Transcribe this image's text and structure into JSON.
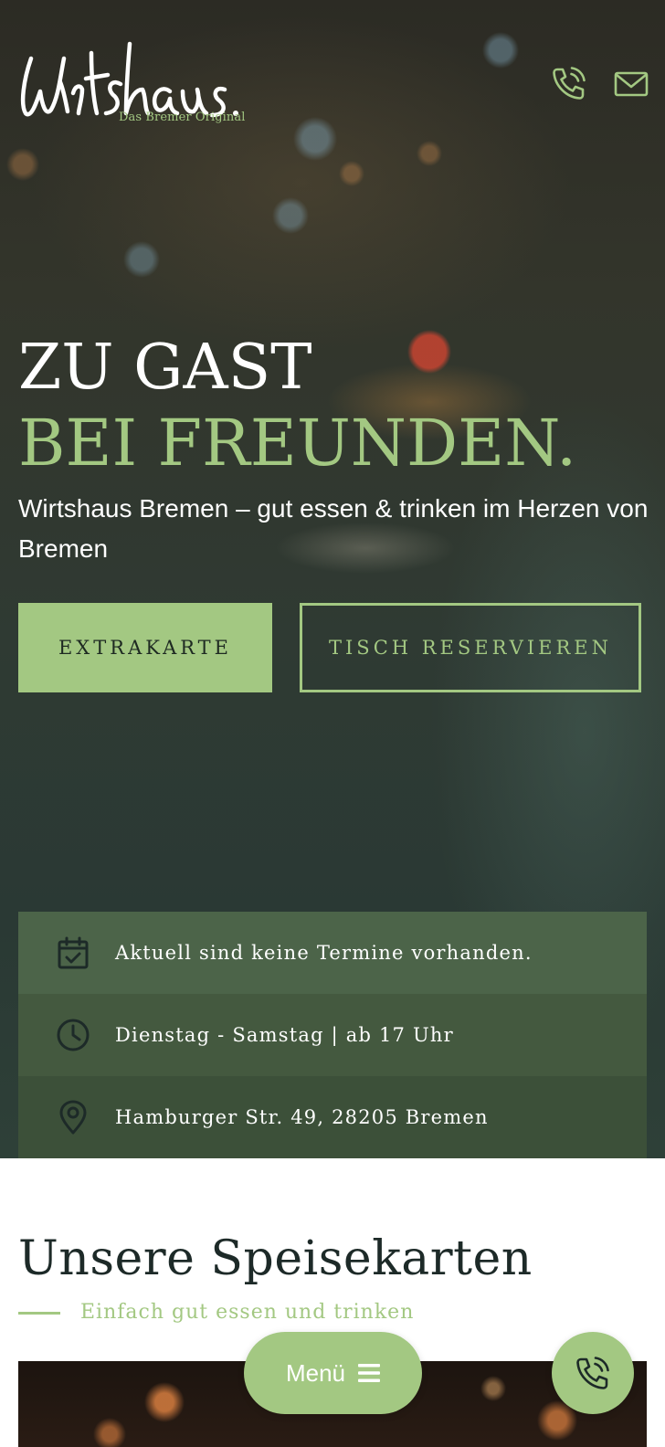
{
  "brand": {
    "logo_text": "Wirtshaus.",
    "tagline": "Das Bremer Original"
  },
  "header": {
    "icons": [
      "phone-icon",
      "mail-icon"
    ]
  },
  "hero": {
    "headline_line1": "ZU GAST",
    "headline_line2": "BEI FREUNDEN.",
    "subline": "Wirtshaus Bremen – gut essen & trinken im Herzen von Bremen",
    "primary_button": "EXTRAKARTE",
    "secondary_button": "TISCH RESERVIEREN"
  },
  "info": {
    "events": "Aktuell sind keine Termine vorhanden.",
    "hours": "Dienstag - Samstag | ab 17 Uhr",
    "address": "Hamburger Str. 49, 28205 Bremen"
  },
  "menus_section": {
    "title": "Unsere Speisekarten",
    "subtitle": "Einfach gut essen und trinken"
  },
  "floating": {
    "menu_label": "Menü"
  },
  "colors": {
    "accent": "#a3c882",
    "dark_text": "#1d2a28",
    "info_bg_1": "#4c6449",
    "info_bg_2": "#44593f",
    "info_bg_3": "#3c5039"
  }
}
